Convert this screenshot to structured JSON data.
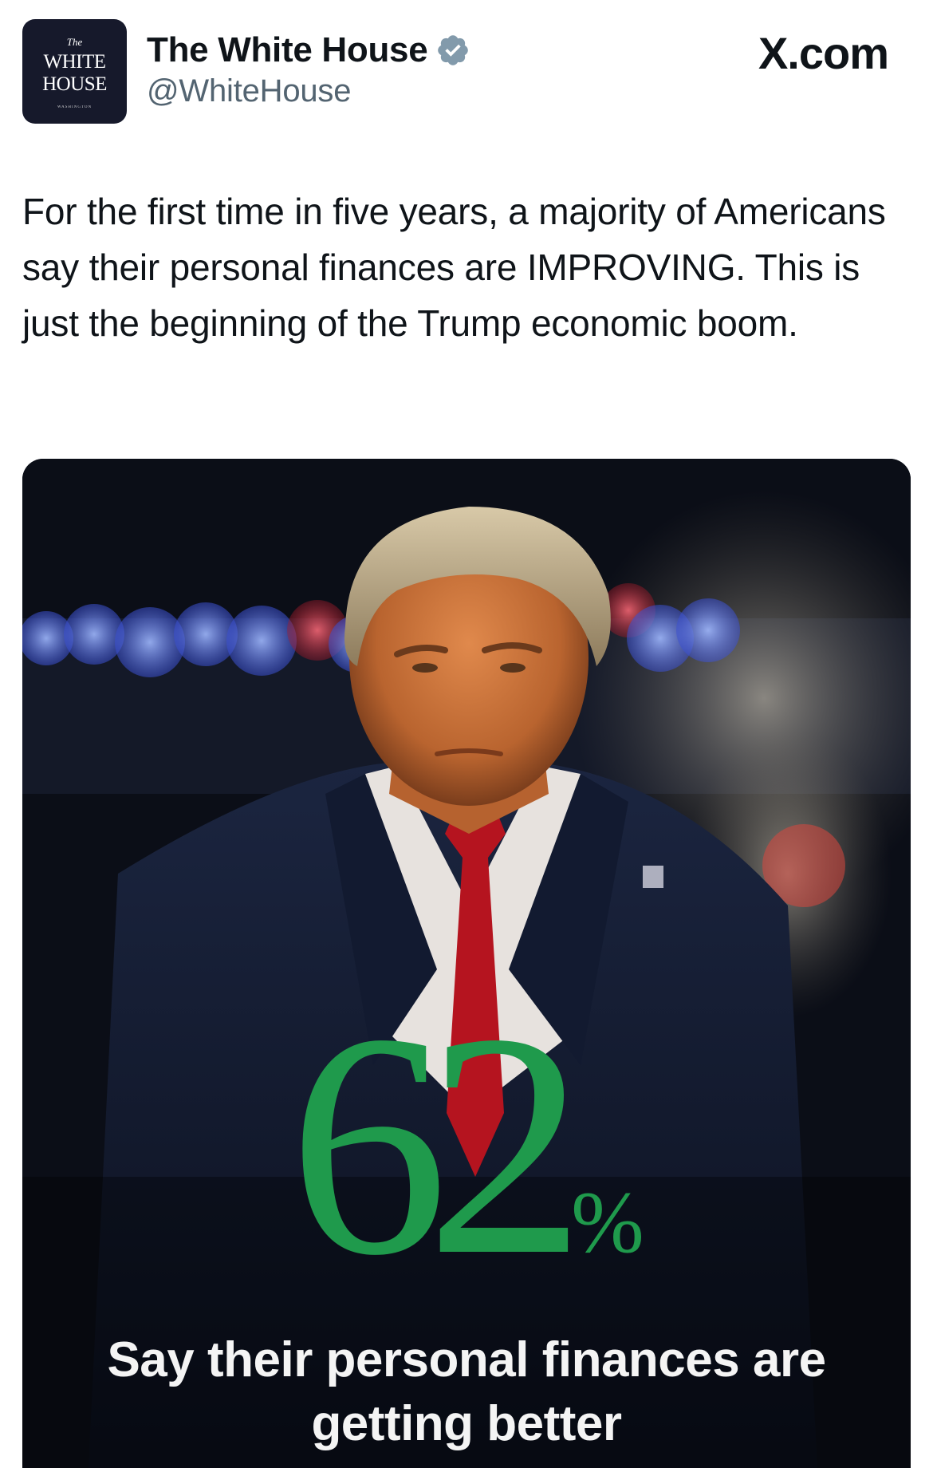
{
  "account": {
    "display_name": "The White House",
    "handle": "@WhiteHouse",
    "avatar": {
      "line1": "The",
      "line2": "WHITE",
      "line3": "HOUSE",
      "line4": "WASHINGTON"
    },
    "verified_icon": "verified-badge-icon"
  },
  "site_label": "X.com",
  "tweet": {
    "text": "For the first time in five years, a majority of Americans say their personal finances are IMPROVING. This is just the beginning of the Trump economic boom."
  },
  "media": {
    "stat_value": "62",
    "stat_unit": "%",
    "caption_line1": "Say their personal finances are",
    "caption_line2": "getting better",
    "colors": {
      "stat": "#1f9a4c",
      "caption": "#f4f4f4",
      "background": "#0c0e16"
    }
  }
}
